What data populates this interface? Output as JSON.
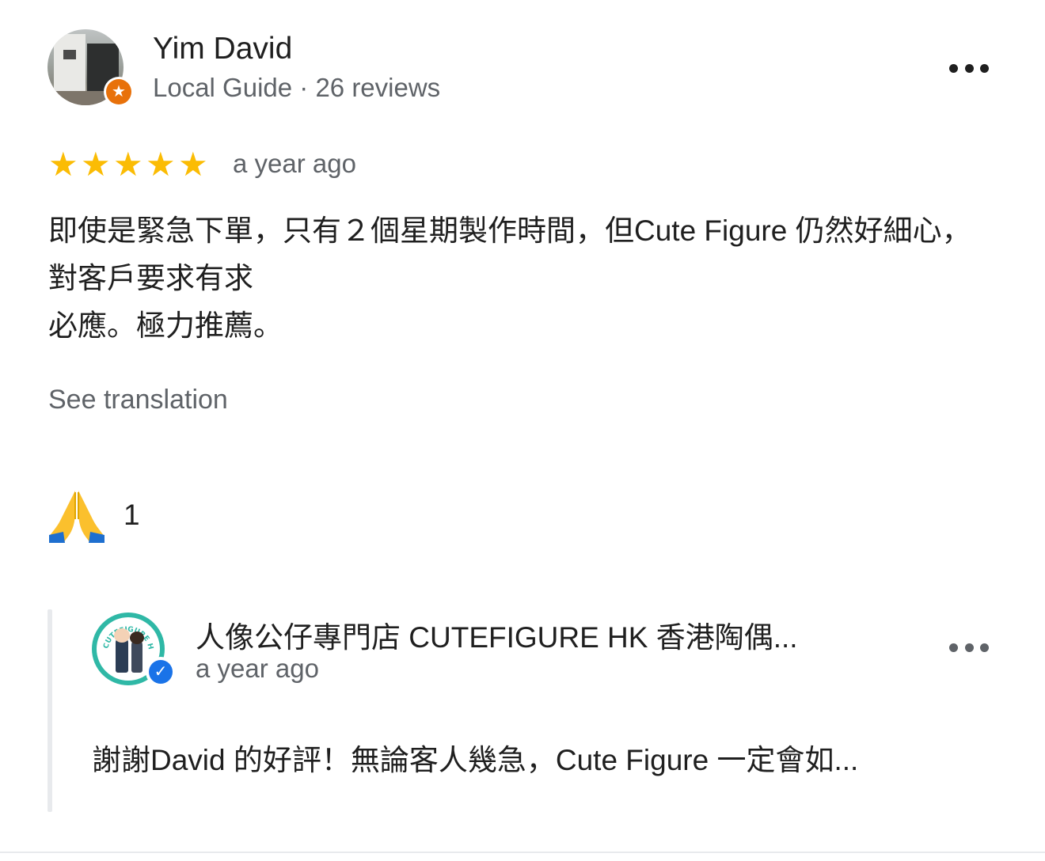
{
  "author": {
    "name": "Yim David",
    "meta": "Local Guide · 26 reviews"
  },
  "icons": {
    "local_guide_badge": "star-badge-icon",
    "more": "more-horizontal-icon",
    "reaction": "folded-hands-icon",
    "verified": "verified-check-icon"
  },
  "colors": {
    "star": "#fbbc04",
    "local_guide_badge": "#e8710a",
    "verified_badge": "#1a73e8",
    "secondary_text": "#5f6368"
  },
  "review": {
    "rating": 5,
    "rating_max": 5,
    "date": "a year ago",
    "text": "即使是緊急下單，只有２個星期製作時間，但Cute Figure 仍然好細心，對客戶要求有求\n必應。極力推薦。",
    "see_translation": "See translation"
  },
  "reaction": {
    "emoji": "🙏",
    "count": "1"
  },
  "owner_reply": {
    "name": "人像公仔專門店 CUTEFIGURE HK 香港陶偶...",
    "avatar_text": "CUTEFIGURE HK",
    "date": "a year ago",
    "text": "謝謝David 的好評！無論客人幾急，Cute Figure 一定會如..."
  }
}
